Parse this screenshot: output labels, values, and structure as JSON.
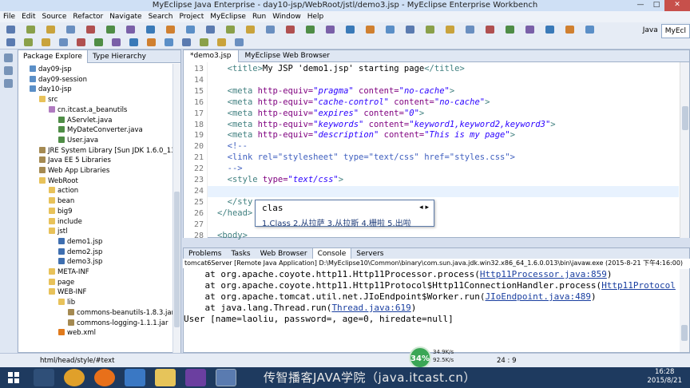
{
  "window": {
    "title": "MyEclipse Java Enterprise - day10-jsp/WebRoot/jstl/demo3.jsp - MyEclipse Enterprise Workbench",
    "minimize": "—",
    "maximize": "□",
    "close": "✕"
  },
  "menu": [
    "File",
    "Edit",
    "Source",
    "Refactor",
    "Navigate",
    "Search",
    "Project",
    "MyEclipse",
    "Run",
    "Window",
    "Help"
  ],
  "perspectives": {
    "java": "Java",
    "myeclipse": "MyEcl"
  },
  "left_tabs": {
    "package_explorer": "Package Explore",
    "type_hierarchy": "Type Hierarchy"
  },
  "tree": [
    {
      "label": "day09-jsp",
      "icon": "project-icon",
      "indent": 0
    },
    {
      "label": "day09-session",
      "icon": "project-icon",
      "indent": 0
    },
    {
      "label": "day10-jsp",
      "icon": "project-icon",
      "indent": 0
    },
    {
      "label": "src",
      "icon": "source-folder-icon",
      "indent": 1
    },
    {
      "label": "cn.itcast.a_beanutils",
      "icon": "package-icon",
      "indent": 2
    },
    {
      "label": "AServlet.java",
      "icon": "java-file-icon",
      "indent": 3
    },
    {
      "label": "MyDateConverter.java",
      "icon": "java-file-icon",
      "indent": 3
    },
    {
      "label": "User.java",
      "icon": "java-file-icon",
      "indent": 3
    },
    {
      "label": "JRE System Library [Sun JDK 1.6.0_13]",
      "icon": "library-icon",
      "indent": 1
    },
    {
      "label": "Java EE 5 Libraries",
      "icon": "library-icon",
      "indent": 1
    },
    {
      "label": "Web App Libraries",
      "icon": "library-icon",
      "indent": 1
    },
    {
      "label": "WebRoot",
      "icon": "folder-icon",
      "indent": 1
    },
    {
      "label": "action",
      "icon": "folder-icon",
      "indent": 2
    },
    {
      "label": "bean",
      "icon": "folder-icon",
      "indent": 2
    },
    {
      "label": "big9",
      "icon": "folder-icon",
      "indent": 2
    },
    {
      "label": "include",
      "icon": "folder-icon",
      "indent": 2
    },
    {
      "label": "jstl",
      "icon": "folder-icon",
      "indent": 2
    },
    {
      "label": "demo1.jsp",
      "icon": "jsp-file-icon",
      "indent": 3
    },
    {
      "label": "demo2.jsp",
      "icon": "jsp-file-icon",
      "indent": 3
    },
    {
      "label": "demo3.jsp",
      "icon": "jsp-file-icon",
      "indent": 3
    },
    {
      "label": "META-INF",
      "icon": "folder-icon",
      "indent": 2
    },
    {
      "label": "page",
      "icon": "folder-icon",
      "indent": 2
    },
    {
      "label": "WEB-INF",
      "icon": "folder-icon",
      "indent": 2
    },
    {
      "label": "lib",
      "icon": "folder-icon",
      "indent": 3
    },
    {
      "label": "commons-beanutils-1.8.3.jar",
      "icon": "jar-file-icon",
      "indent": 4
    },
    {
      "label": "commons-logging-1.1.1.jar",
      "icon": "jar-file-icon",
      "indent": 4
    },
    {
      "label": "web.xml",
      "icon": "xml-file-icon",
      "indent": 3
    }
  ],
  "editor_tabs": {
    "active": "*demo3.jsp",
    "other": "MyEclipse Web Browser"
  },
  "editor": {
    "lines": [
      {
        "n": "13",
        "parts": [
          [
            "tg",
            "<title>"
          ],
          [
            "tx",
            "My JSP 'demo1.jsp' starting page"
          ],
          [
            "tg",
            "</title>"
          ]
        ]
      },
      {
        "n": "14",
        "parts": []
      },
      {
        "n": "15",
        "parts": [
          [
            "tg",
            "<meta "
          ],
          [
            "at",
            "http-equiv="
          ],
          [
            "vl",
            "\"pragma\""
          ],
          [
            "at",
            " content="
          ],
          [
            "vl",
            "\"no-cache\""
          ],
          [
            "tg",
            ">"
          ]
        ]
      },
      {
        "n": "16",
        "parts": [
          [
            "tg",
            "<meta "
          ],
          [
            "at",
            "http-equiv="
          ],
          [
            "vl",
            "\"cache-control\""
          ],
          [
            "at",
            " content="
          ],
          [
            "vl",
            "\"no-cache\""
          ],
          [
            "tg",
            ">"
          ]
        ]
      },
      {
        "n": "17",
        "parts": [
          [
            "tg",
            "<meta "
          ],
          [
            "at",
            "http-equiv="
          ],
          [
            "vl",
            "\"expires\""
          ],
          [
            "at",
            " content="
          ],
          [
            "vl",
            "\"0\""
          ],
          [
            "tg",
            ">"
          ]
        ]
      },
      {
        "n": "18",
        "parts": [
          [
            "tg",
            "<meta "
          ],
          [
            "at",
            "http-equiv="
          ],
          [
            "vl",
            "\"keywords\""
          ],
          [
            "at",
            " content="
          ],
          [
            "vl",
            "\"keyword1,keyword2,keyword3\""
          ],
          [
            "tg",
            ">"
          ]
        ]
      },
      {
        "n": "19",
        "parts": [
          [
            "tg",
            "<meta "
          ],
          [
            "at",
            "http-equiv="
          ],
          [
            "vl",
            "\"description\""
          ],
          [
            "at",
            " content="
          ],
          [
            "vl",
            "\"This is my page\""
          ],
          [
            "tg",
            ">"
          ]
        ]
      },
      {
        "n": "20",
        "parts": [
          [
            "cm",
            "<!--"
          ]
        ]
      },
      {
        "n": "21",
        "parts": [
          [
            "cm",
            "<link rel=\"stylesheet\" type=\"text/css\" href=\"styles.css\">"
          ]
        ]
      },
      {
        "n": "22",
        "parts": [
          [
            "cm",
            "-->"
          ]
        ]
      },
      {
        "n": "23",
        "parts": [
          [
            "tg",
            "<style "
          ],
          [
            "at",
            "type="
          ],
          [
            "vl",
            "\"text/css\""
          ],
          [
            "tg",
            ">"
          ]
        ]
      },
      {
        "n": "24",
        "parts": []
      },
      {
        "n": "25",
        "parts": [
          [
            "tg",
            "</sty"
          ]
        ]
      },
      {
        "n": "26",
        "parts": [
          [
            "tg",
            "</head>"
          ]
        ]
      },
      {
        "n": "27",
        "parts": []
      },
      {
        "n": "28",
        "parts": [
          [
            "tg",
            "<body>"
          ]
        ]
      }
    ]
  },
  "autocomplete": {
    "query": "clas",
    "options": "1.Class 2.从拉萨 3.从拉斯 4.栅啦 5.出啦"
  },
  "console_tabs": [
    "Problems",
    "Tasks",
    "Web Browser",
    "Console",
    "Servers"
  ],
  "console": {
    "header": "tomcat6Server [Remote Java Application] D:\\MyEclipse10\\Common\\binary\\com.sun.java.jdk.win32.x86_64_1.6.0.013\\bin\\javaw.exe (2015-8-21 下午4:16:00)",
    "lines": [
      [
        [
          "tx",
          "    at org.apache.coyote.http11.Http11Processor.process("
        ],
        [
          "lk",
          "Http11Processor.java:859"
        ],
        [
          "tx",
          ")"
        ]
      ],
      [
        [
          "tx",
          "    at org.apache.coyote.http11.Http11Protocol$Http11ConnectionHandler.process("
        ],
        [
          "lk",
          "Http11Protocol"
        ]
      ],
      [
        [
          "tx",
          "    at org.apache.tomcat.util.net.JIoEndpoint$Worker.run("
        ],
        [
          "lk",
          "JIoEndpoint.java:489"
        ],
        [
          "tx",
          ")"
        ]
      ],
      [
        [
          "tx",
          "    at java.lang.Thread.run("
        ],
        [
          "lk",
          "Thread.java:619"
        ],
        [
          "tx",
          ")"
        ]
      ],
      [
        [
          "tx",
          "User [name=laoliu, password=, age=0, hiredate=null]"
        ]
      ]
    ]
  },
  "status": {
    "path": "html/head/style/#text",
    "position": "24 : 9"
  },
  "network": {
    "percent": "34%",
    "up": "34.9K/s",
    "down": "92.5K/s"
  },
  "watermark": "传智播客JAVA学院（java.itcast.cn）",
  "clock": {
    "time": "16:28",
    "date": "2015/8/21"
  }
}
